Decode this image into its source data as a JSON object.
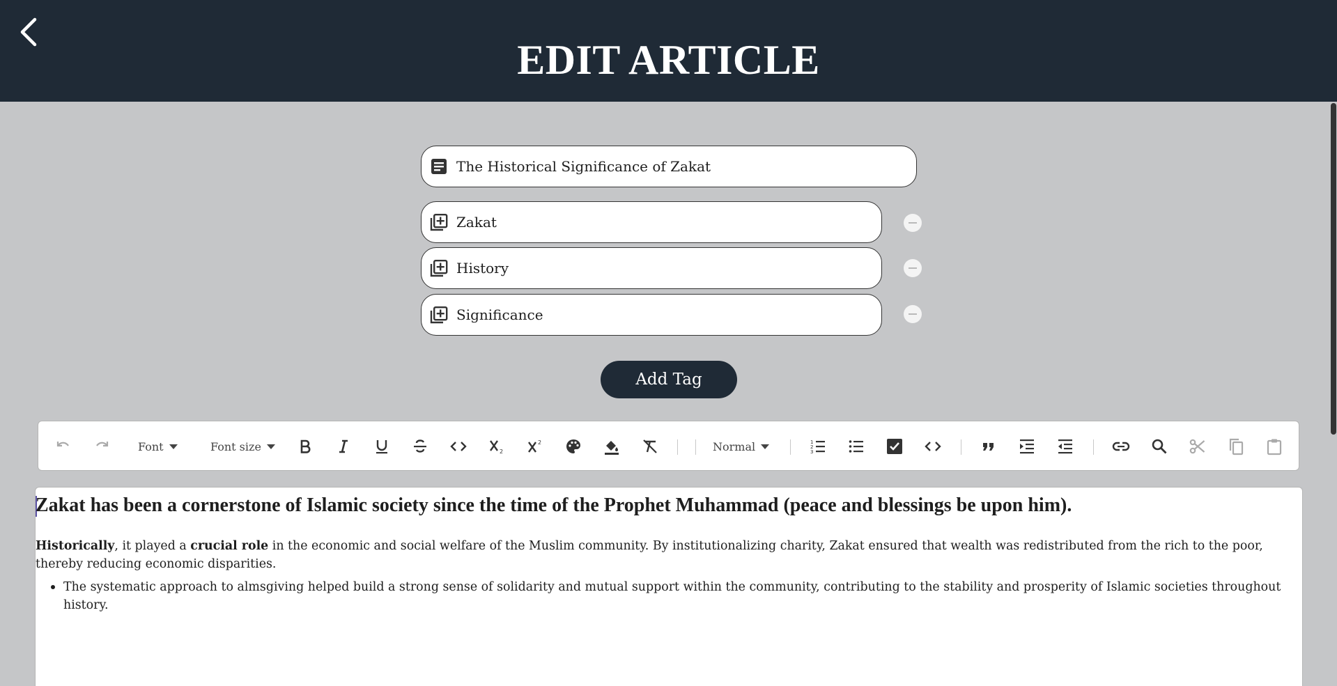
{
  "header": {
    "title": "EDIT ARTICLE",
    "back_icon": "chevron-left-icon"
  },
  "article": {
    "title_value": "The Historical Significance of Zakat",
    "title_icon": "article-icon",
    "tags": [
      "Zakat",
      "History",
      "Significance"
    ],
    "tag_icon": "library-add-icon",
    "remove_icon": "minus-circle-icon"
  },
  "add_tag_label": "Add Tag",
  "toolbar": {
    "font_label": "Font",
    "font_size_label": "Font size",
    "block_label": "Normal",
    "icons": [
      "undo-icon",
      "redo-icon",
      "bold-icon",
      "italic-icon",
      "underline-icon",
      "strikethrough-icon",
      "inline-code-icon",
      "subscript-icon",
      "superscript-icon",
      "palette-icon",
      "fill-color-icon",
      "clear-format-icon",
      "ordered-list-icon",
      "bullet-list-icon",
      "checkbox-icon",
      "code-block-icon",
      "quote-icon",
      "indent-icon",
      "outdent-icon",
      "link-icon",
      "search-icon",
      "cut-icon",
      "copy-icon",
      "paste-icon"
    ]
  },
  "content": {
    "heading": "Zakat has been a cornerstone of Islamic society since the time of the Prophet Muhammad (peace and blessings be upon him).",
    "p_bold1": "Historically",
    "p_text1": ", it played a ",
    "p_bold2": "crucial role",
    "p_text2": " in the economic and social welfare of the Muslim community. By institutionalizing charity, Zakat ensured that wealth was redistributed from the rich to the poor, thereby reducing economic disparities.",
    "bullet": "The systematic approach to almsgiving helped build a strong sense of solidarity and mutual support within the community, contributing to the stability and prosperity of Islamic societies throughout history."
  },
  "colors": {
    "header_bg": "#1f2a36",
    "page_bg": "#c5c6c8",
    "button_bg": "#1f2a36"
  }
}
